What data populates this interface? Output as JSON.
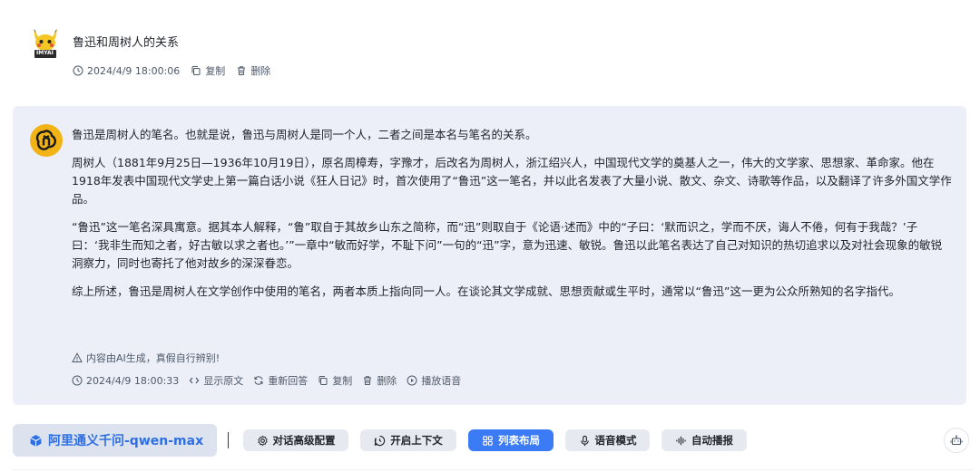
{
  "user_message": {
    "title": "鲁迅和周树人的关系",
    "avatar_label": "IMYAI",
    "timestamp": "2024/4/9 18:00:06",
    "copy_label": "复制",
    "delete_label": "删除"
  },
  "ai_message": {
    "paragraphs": [
      "鲁迅是周树人的笔名。也就是说，鲁迅与周树人是同一个人，二者之间是本名与笔名的关系。",
      "周树人（1881年9月25日—1936年10月19日），原名周樟寿，字豫才，后改名为周树人，浙江绍兴人，中国现代文学的奠基人之一，伟大的文学家、思想家、革命家。他在1918年发表中国现代文学史上第一篇白话小说《狂人日记》时，首次使用了“鲁迅”这一笔名，并以此名发表了大量小说、散文、杂文、诗歌等作品，以及翻译了许多外国文学作品。",
      "“鲁迅”这一笔名深具寓意。据其本人解释，“鲁”取自于其故乡山东之简称，而“迅”则取自于《论语·述而》中的“子曰：‘默而识之，学而不厌，诲人不倦，何有于我哉？’子曰：‘我非生而知之者，好古敏以求之者也。’”一章中“敏而好学，不耻下问”一句的“迅”字，意为迅速、敏锐。鲁迅以此笔名表达了自己对知识的热切追求以及对社会现象的敏锐洞察力，同时也寄托了他对故乡的深深眷恋。",
      "综上所述，鲁迅是周树人在文学创作中使用的笔名，两者本质上指向同一人。在谈论其文学成就、思想贡献或生平时，通常以“鲁迅”这一更为公众所熟知的名字指代。"
    ],
    "notice": "内容由AI生成，真假自行辨别!",
    "timestamp": "2024/4/9 18:00:33",
    "show_source_label": "显示原文",
    "regenerate_label": "重新回答",
    "copy_label": "复制",
    "delete_label": "删除",
    "play_label": "播放语音"
  },
  "toolbar": {
    "model_label": "阿里通义千问-qwen-max",
    "advanced_label": "对话高级配置",
    "context_label": "开启上下文",
    "list_layout_label": "列表布局",
    "voice_mode_label": "语音模式",
    "auto_play_label": "自动播报"
  },
  "colors": {
    "accent": "#3b7bf6",
    "model_text": "#2f6fe4",
    "card_bg": "#eceff7"
  }
}
